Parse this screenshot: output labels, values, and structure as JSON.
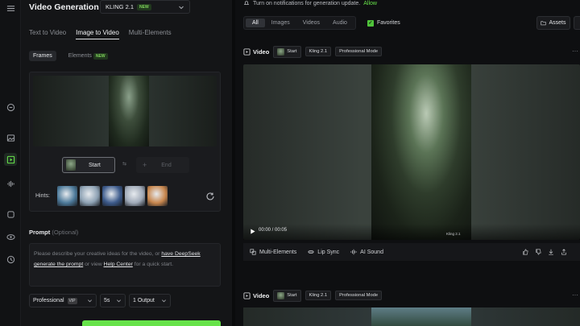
{
  "app": {
    "title": "Video Generation",
    "model": "KLING 2.1",
    "model_badge": "NEW"
  },
  "mode_tabs": [
    {
      "label": "Text to Video",
      "active": false
    },
    {
      "label": "Image to Video",
      "active": true
    },
    {
      "label": "Multi-Elements",
      "active": false
    }
  ],
  "sub_tabs": {
    "frames": "Frames",
    "elements": "Elements",
    "elements_badge": "NEW"
  },
  "frames": {
    "start_label": "Start",
    "swap_label": "⇆",
    "end_plus": "+",
    "end_label": "End",
    "hints_label": "Hints:",
    "hint_colors": [
      "#4d7a9a",
      "#8ea2b4",
      "#3d5b8c",
      "#a0aab8",
      "#c8874e"
    ]
  },
  "prompt": {
    "label": "Prompt",
    "optional": "(Optional)",
    "text_1": "Please describe your creative ideas for the video, or ",
    "link_1a": "have DeepSeek",
    "link_1b": "generate the prompt",
    "text_2": " or view ",
    "link_2": "Help Center",
    "text_3": " for a quick start."
  },
  "settings": {
    "mode": "Professional",
    "mode_badge": "VIP",
    "duration": "5s",
    "outputs": "1 Output"
  },
  "notice": {
    "text": "Turn on notifications for generation update.",
    "allow": "Allow"
  },
  "filters": [
    "All",
    "Images",
    "Videos",
    "Audio"
  ],
  "favorites_label": "Favorites",
  "assets_label": "Assets",
  "results": [
    {
      "title": "Video",
      "start_chip": "Start",
      "model_chip": "Kling 2.1",
      "mode_chip": "Professional Mode",
      "time": "00:00 / 00:05",
      "watermark": "Kling 2.1"
    },
    {
      "title": "Video",
      "start_chip": "Start",
      "model_chip": "Kling 2.1",
      "mode_chip": "Professional Mode"
    }
  ],
  "actions": {
    "multi_elements": "Multi-Elements",
    "lip_sync": "Lip Sync",
    "ai_sound": "AI Sound"
  },
  "more_label": "···"
}
